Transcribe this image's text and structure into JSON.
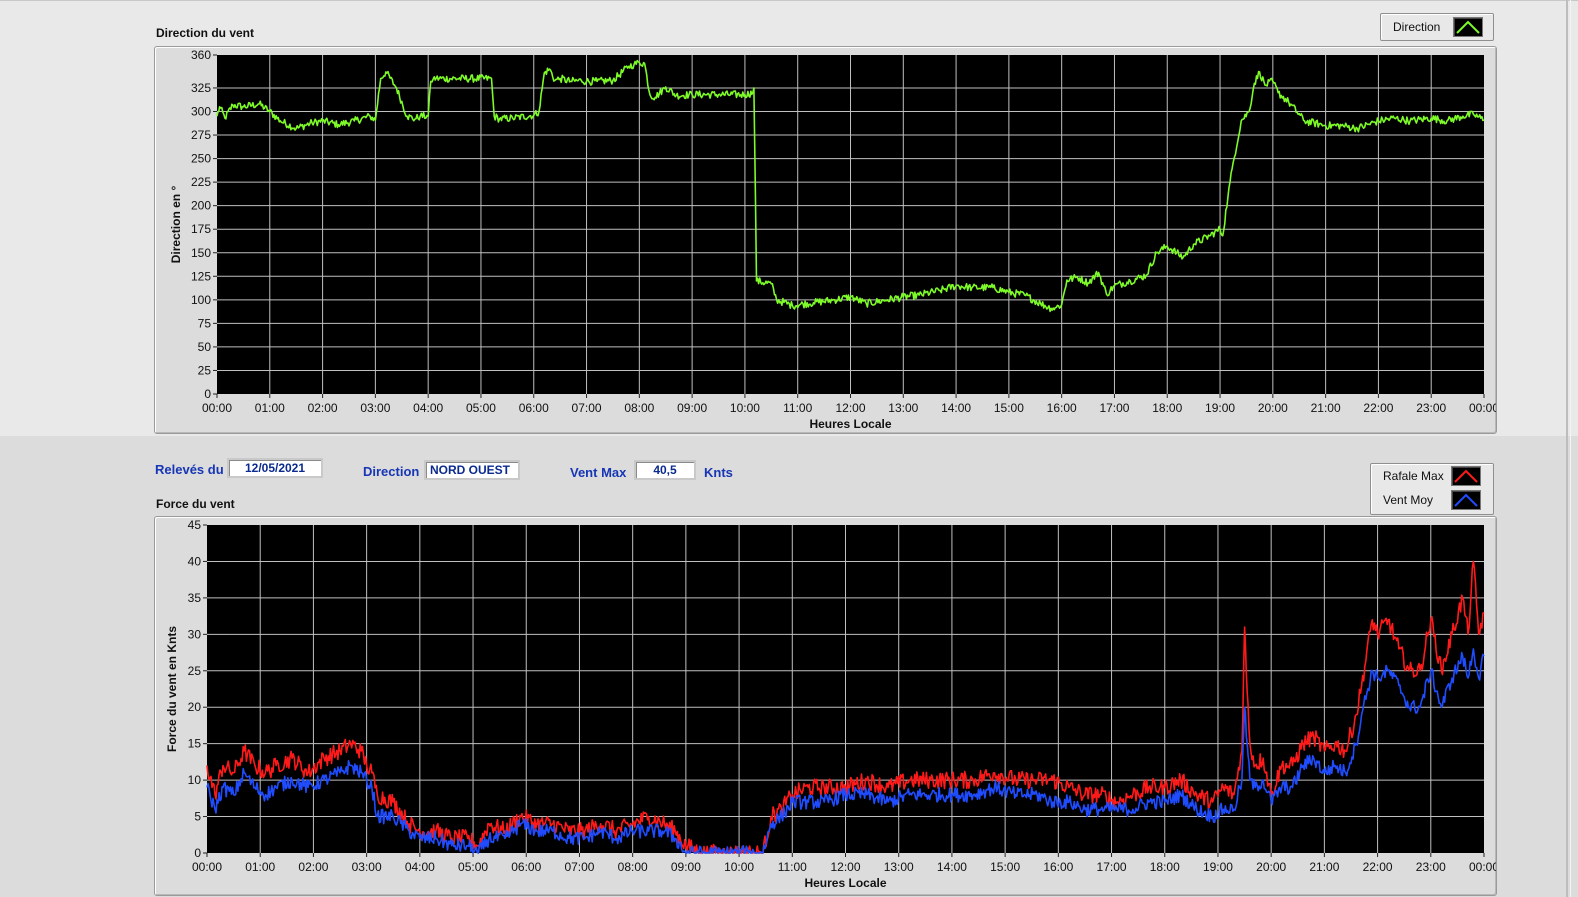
{
  "direction_panel": {
    "title": "Direction du vent",
    "legend_label": "Direction"
  },
  "info_bar": {
    "date_label": "Relevés du",
    "date_value": "12/05/2021",
    "direction_label": "Direction",
    "direction_value": "NORD OUEST",
    "vent_max_label": "Vent Max",
    "vent_max_value": "40,5",
    "vent_max_unit": "Knts"
  },
  "force_panel": {
    "title": "Force du vent",
    "legend": [
      "Rafale Max",
      "Vent Moy"
    ]
  },
  "colors": {
    "direction": "#7dfa28",
    "rafale": "#ff1a1a",
    "moyen": "#1f4cff",
    "plot_bg": "#000000",
    "grid": "#c0c0c0"
  },
  "chart_data": [
    {
      "type": "line",
      "xlabel": "Heures Locale",
      "ylabel": "Direction en °",
      "xlim": [
        0,
        24
      ],
      "ylim": [
        0,
        360
      ],
      "y_ticks": [
        0,
        25,
        50,
        75,
        100,
        125,
        150,
        175,
        200,
        225,
        250,
        275,
        300,
        325,
        360
      ],
      "x_ticks": [
        "00:00",
        "01:00",
        "02:00",
        "03:00",
        "04:00",
        "05:00",
        "06:00",
        "07:00",
        "08:00",
        "09:00",
        "10:00",
        "11:00",
        "12:00",
        "13:00",
        "14:00",
        "15:00",
        "16:00",
        "17:00",
        "18:00",
        "19:00",
        "20:00",
        "21:00",
        "22:00",
        "23:00",
        "00:00"
      ],
      "grid": true,
      "legend_position": "top-right",
      "series": [
        {
          "name": "Direction",
          "x": [
            0,
            0.05,
            0.15,
            0.3,
            0.5,
            0.8,
            1.0,
            1.2,
            1.5,
            1.8,
            2.0,
            2.3,
            2.6,
            2.9,
            3.0,
            3.1,
            3.2,
            3.4,
            3.6,
            3.75,
            3.85,
            4.0,
            4.05,
            4.1,
            4.15,
            5.2,
            5.25,
            5.35,
            5.6,
            6.0,
            6.1,
            6.2,
            6.3,
            6.4,
            6.5,
            6.7,
            6.9,
            7.0,
            7.2,
            7.5,
            7.8,
            7.9,
            8.0,
            8.1,
            8.2,
            8.3,
            8.5,
            8.7,
            9.0,
            9.5,
            10.0,
            10.15,
            10.17,
            10.2,
            10.22,
            10.5,
            10.6,
            10.9,
            11.3,
            11.7,
            12.0,
            12.3,
            12.7,
            13.0,
            13.3,
            13.7,
            14.0,
            14.3,
            14.7,
            15.0,
            15.3,
            15.6,
            15.8,
            15.9,
            16.0,
            16.1,
            16.3,
            16.5,
            16.7,
            16.85,
            17.0,
            17.3,
            17.6,
            17.8,
            18.0,
            18.3,
            18.5,
            18.8,
            19.0,
            19.05,
            19.15,
            19.25,
            19.4,
            19.55,
            19.65,
            19.75,
            19.85,
            20.0,
            20.1,
            20.3,
            20.6,
            21.0,
            21.3,
            21.6,
            22.0,
            22.3,
            22.6,
            23.0,
            23.3,
            23.6,
            23.8,
            24.0
          ],
          "values": [
            295,
            305,
            293,
            307,
            305,
            308,
            300,
            290,
            282,
            288,
            290,
            286,
            290,
            295,
            291,
            335,
            342,
            325,
            295,
            292,
            295,
            295,
            332,
            335,
            335,
            335,
            295,
            292,
            293,
            296,
            300,
            341,
            345,
            333,
            335,
            332,
            333,
            332,
            332,
            333,
            348,
            350,
            352,
            351,
            318,
            315,
            326,
            317,
            318,
            318,
            318,
            320,
            325,
            205,
            120,
            117,
            100,
            94,
            97,
            100,
            103,
            96,
            100,
            103,
            105,
            110,
            115,
            113,
            113,
            108,
            105,
            96,
            91,
            92,
            95,
            121,
            124,
            118,
            129,
            106,
            115,
            120,
            126,
            150,
            157,
            145,
            159,
            168,
            175,
            168,
            210,
            246,
            290,
            300,
            330,
            342,
            328,
            332,
            320,
            310,
            290,
            285,
            285,
            282,
            290,
            293,
            290,
            293,
            290,
            295,
            297,
            291
          ]
        }
      ]
    },
    {
      "type": "line",
      "xlabel": "Heures Locale",
      "ylabel": "Force du vent en Knts",
      "xlim": [
        0,
        24
      ],
      "ylim": [
        0,
        45
      ],
      "y_ticks": [
        0,
        5,
        10,
        15,
        20,
        25,
        30,
        35,
        40,
        45
      ],
      "x_ticks": [
        "00:00",
        "01:00",
        "02:00",
        "03:00",
        "04:00",
        "05:00",
        "06:00",
        "07:00",
        "08:00",
        "09:00",
        "10:00",
        "11:00",
        "12:00",
        "13:00",
        "14:00",
        "15:00",
        "16:00",
        "17:00",
        "18:00",
        "19:00",
        "20:00",
        "21:00",
        "22:00",
        "23:00",
        "00:00"
      ],
      "grid": true,
      "legend_position": "top-right",
      "series": [
        {
          "name": "Rafale Max",
          "x": [
            0,
            0.15,
            0.3,
            0.5,
            0.7,
            0.9,
            1.1,
            1.3,
            1.6,
            1.9,
            2.2,
            2.5,
            2.7,
            2.9,
            3.0,
            3.1,
            3.2,
            3.5,
            3.8,
            4.0,
            4.3,
            4.6,
            4.9,
            5.1,
            5.3,
            5.6,
            5.9,
            6.2,
            6.5,
            6.8,
            7.1,
            7.4,
            7.7,
            8.0,
            8.3,
            8.6,
            8.8,
            9.0,
            9.3,
            9.6,
            10.0,
            10.3,
            10.45,
            10.6,
            10.8,
            11.0,
            11.3,
            11.6,
            12.0,
            12.4,
            12.8,
            13.2,
            13.6,
            14.0,
            14.4,
            14.8,
            15.2,
            15.6,
            15.9,
            16.2,
            16.5,
            16.8,
            17.1,
            17.4,
            17.7,
            18.0,
            18.3,
            18.6,
            18.9,
            19.1,
            19.3,
            19.45,
            19.5,
            19.55,
            19.6,
            19.7,
            19.85,
            20.0,
            20.2,
            20.4,
            20.6,
            20.8,
            21.0,
            21.2,
            21.4,
            21.6,
            21.7,
            21.9,
            22.0,
            22.2,
            22.4,
            22.6,
            22.8,
            23.0,
            23.2,
            23.4,
            23.6,
            23.7,
            23.8,
            23.9,
            24.0
          ],
          "values": [
            12,
            8,
            12,
            11,
            14,
            12,
            11,
            12,
            13,
            11,
            13,
            14,
            15,
            14,
            12,
            11,
            8,
            7,
            4,
            3,
            3,
            2,
            2,
            1,
            4,
            3,
            5,
            4,
            4,
            3,
            3,
            4,
            3,
            4,
            5,
            4,
            3,
            1,
            0,
            0,
            0,
            0,
            0,
            5,
            6,
            8,
            9,
            9,
            9,
            10,
            9,
            10,
            10,
            10,
            10,
            11,
            10,
            10,
            10,
            9,
            8,
            8,
            7,
            8,
            9,
            9,
            10,
            8,
            7,
            9,
            8,
            14,
            31,
            22,
            15,
            12,
            13,
            8,
            12,
            12,
            15,
            16,
            14,
            15,
            14,
            19,
            23,
            32,
            30,
            32,
            28,
            25,
            25,
            32,
            25,
            30,
            35,
            30,
            40,
            30,
            33
          ]
        },
        {
          "name": "Vent Moy",
          "x": [
            0,
            0.15,
            0.3,
            0.5,
            0.7,
            0.9,
            1.1,
            1.3,
            1.6,
            1.9,
            2.2,
            2.5,
            2.7,
            2.9,
            3.0,
            3.1,
            3.2,
            3.5,
            3.8,
            4.0,
            4.3,
            4.6,
            4.9,
            5.1,
            5.3,
            5.6,
            5.9,
            6.2,
            6.5,
            6.8,
            7.1,
            7.4,
            7.7,
            8.0,
            8.3,
            8.6,
            8.8,
            9.0,
            9.3,
            9.6,
            10.0,
            10.3,
            10.45,
            10.6,
            10.8,
            11.0,
            11.3,
            11.6,
            12.0,
            12.4,
            12.8,
            13.2,
            13.6,
            14.0,
            14.4,
            14.8,
            15.2,
            15.6,
            15.9,
            16.2,
            16.5,
            16.8,
            17.1,
            17.4,
            17.7,
            18.0,
            18.3,
            18.6,
            18.9,
            19.1,
            19.3,
            19.45,
            19.5,
            19.55,
            19.6,
            19.7,
            19.85,
            20.0,
            20.2,
            20.4,
            20.6,
            20.8,
            21.0,
            21.2,
            21.4,
            21.6,
            21.7,
            21.9,
            22.0,
            22.2,
            22.4,
            22.6,
            22.8,
            23.0,
            23.2,
            23.4,
            23.6,
            23.7,
            23.8,
            23.9,
            24.0
          ],
          "values": [
            9,
            6,
            9,
            8,
            11,
            9,
            8,
            9,
            10,
            9,
            10,
            11,
            12,
            11,
            10,
            9,
            5,
            5,
            3,
            2,
            2,
            1,
            1,
            0,
            2,
            2,
            4,
            3,
            3,
            2,
            2,
            3,
            2,
            3,
            3,
            3,
            2,
            0,
            0,
            0,
            0,
            0,
            0,
            4,
            5,
            7,
            7,
            7,
            8,
            8,
            7,
            8,
            8,
            8,
            8,
            9,
            8,
            8,
            7,
            7,
            6,
            6,
            6,
            6,
            7,
            7,
            8,
            6,
            5,
            6,
            6,
            10,
            20,
            15,
            10,
            9,
            10,
            7,
            9,
            9,
            12,
            13,
            11,
            12,
            11,
            15,
            19,
            25,
            24,
            25,
            23,
            20,
            20,
            25,
            20,
            24,
            27,
            24,
            28,
            24,
            27
          ]
        }
      ]
    }
  ]
}
